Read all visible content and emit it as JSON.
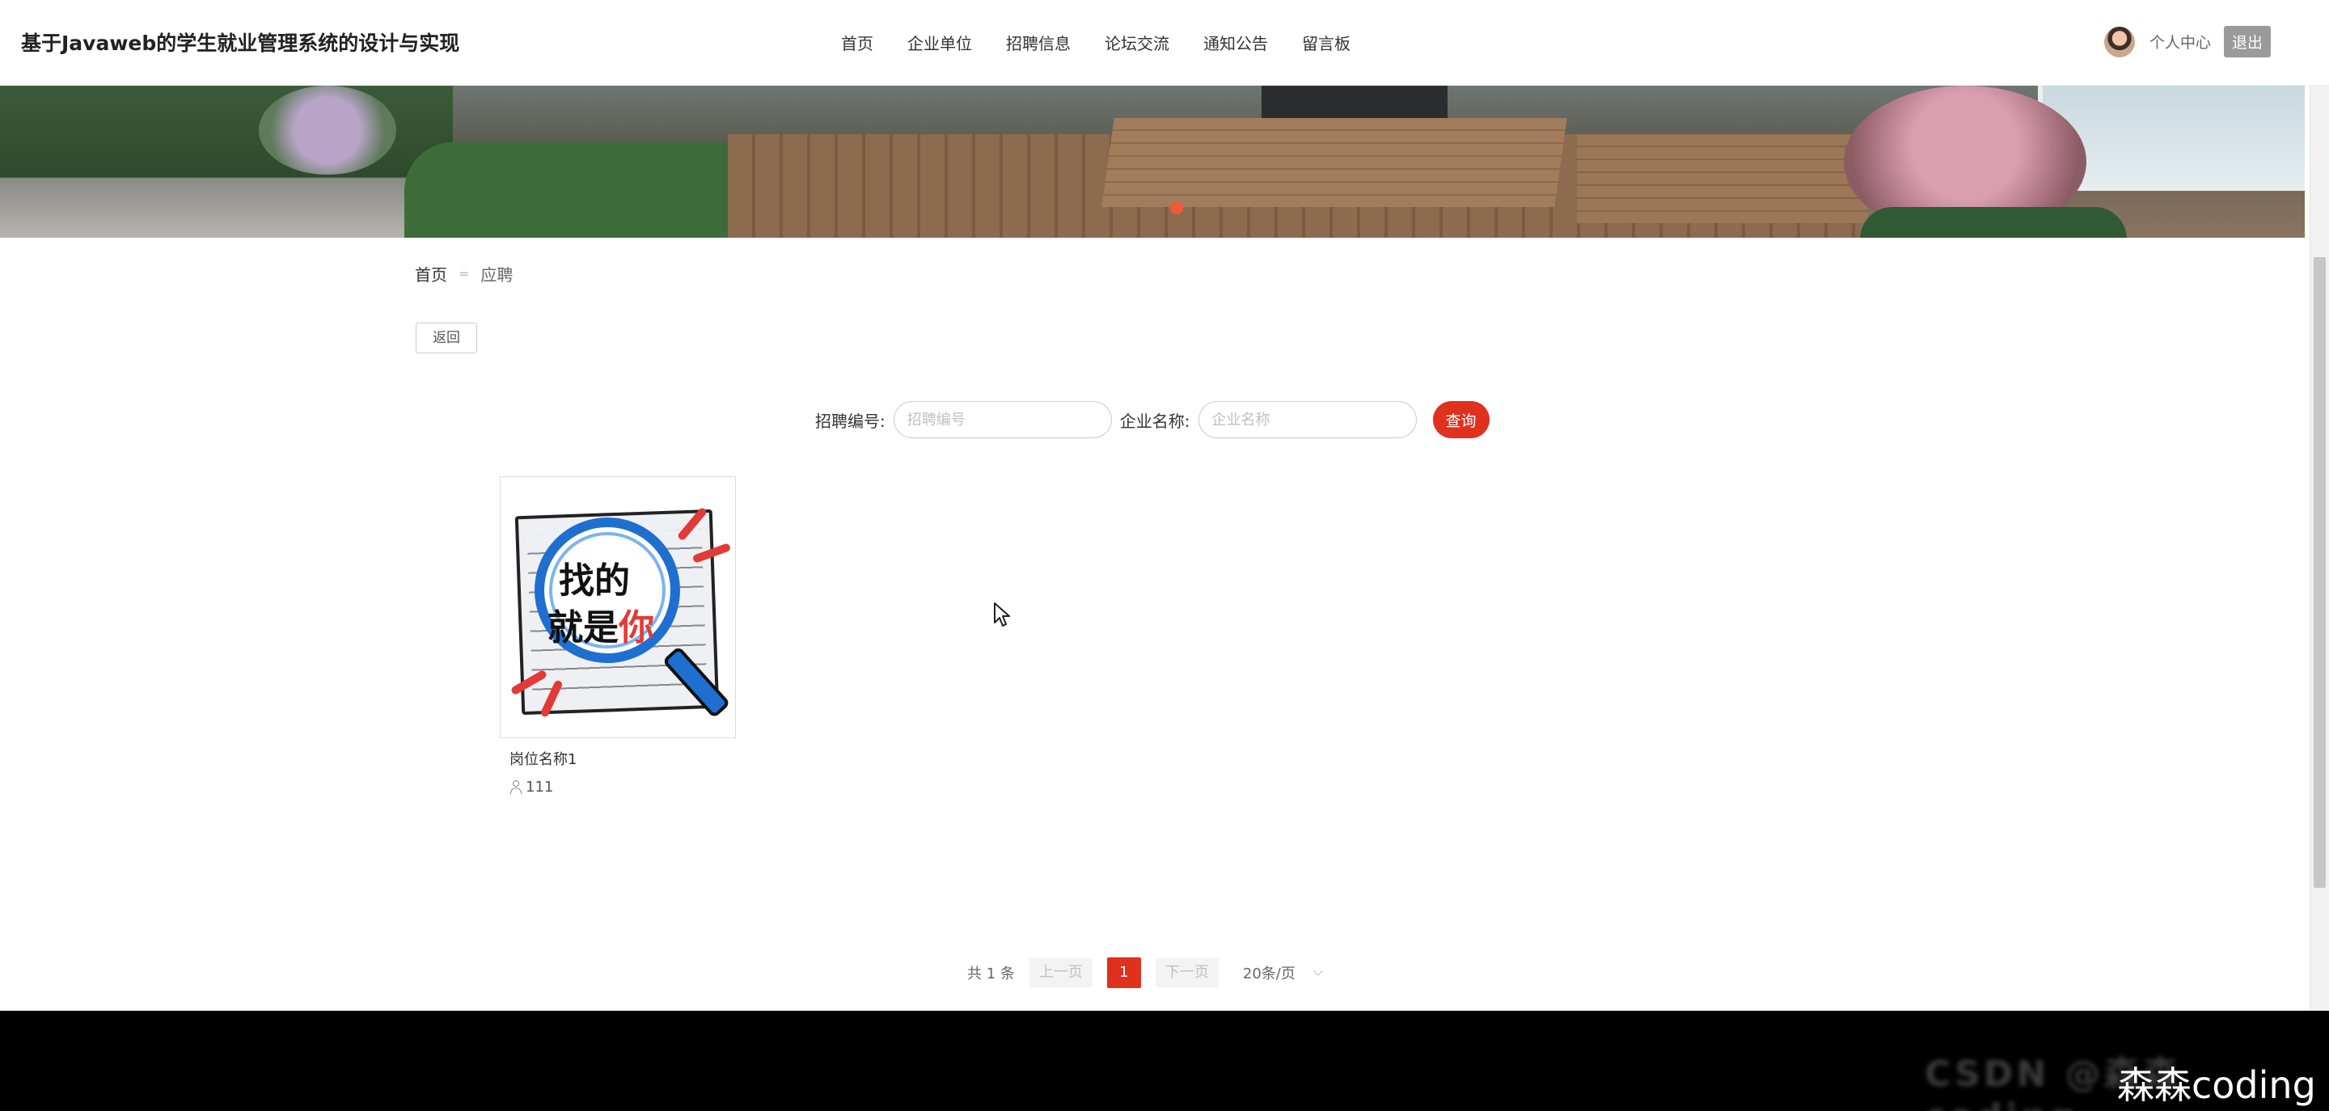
{
  "header": {
    "site_title": "基于Javaweb的学生就业管理系统的设计与实现",
    "nav": [
      {
        "label": "首页"
      },
      {
        "label": "企业单位"
      },
      {
        "label": "招聘信息"
      },
      {
        "label": "论坛交流"
      },
      {
        "label": "通知公告"
      },
      {
        "label": "留言板"
      }
    ],
    "user_center": "个人中心",
    "logout": "退出"
  },
  "breadcrumb": {
    "home": "首页",
    "separator": "=",
    "current": "应聘"
  },
  "back_button": "返回",
  "search": {
    "field1_label": "招聘编号:",
    "field1_placeholder": "招聘编号",
    "field2_label": "企业名称:",
    "field2_placeholder": "企业名称",
    "button": "查询"
  },
  "results": [
    {
      "image_text_line1": "找的",
      "image_text_line2_black": "就是",
      "image_text_line2_red": "你",
      "title": "岗位名称1",
      "count": "111"
    }
  ],
  "pagination": {
    "total": "共 1 条",
    "prev": "上一页",
    "current_page": "1",
    "next": "下一页",
    "page_size": "20条/页"
  },
  "watermark": "森森coding",
  "watermark_faint": "CSDN @森森coding",
  "colors": {
    "accent_red": "#e0301e",
    "banner_dot": "#f05a3c",
    "footer_bg": "#000000"
  }
}
